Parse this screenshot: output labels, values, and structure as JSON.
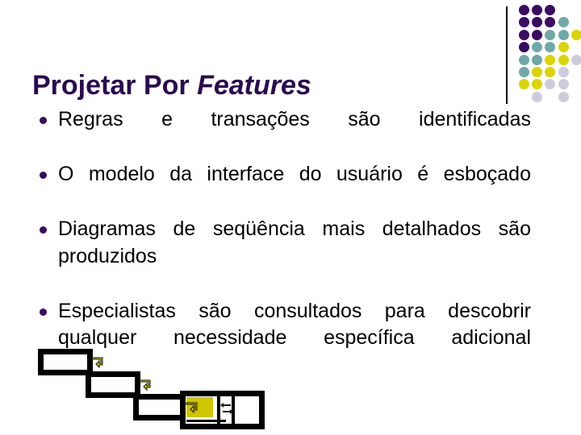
{
  "slide": {
    "title_prefix": "Projetar Por ",
    "title_emphasis": "Features",
    "title_full": "Projetar Por Features",
    "background_color": "#ffffff",
    "title_color": "#2b0a51",
    "body_text_color": "#000000",
    "bullet_marker_color": "#3b0a63"
  },
  "bullets": [
    {
      "text": "Regras e transações são identificadas"
    },
    {
      "text": "O modelo da interface do usuário é esboçado"
    },
    {
      "text": "Diagramas de seqüência mais detalhados são produzidos"
    },
    {
      "text": "Especialistas são consultados para descobrir qualquer necessidade específica adicional"
    }
  ],
  "decor": {
    "rule_color": "#000000",
    "dot_colors": {
      "purple": "#3b0a63",
      "teal": "#6fa8a8",
      "yellow": "#dbd400",
      "lavender": "#ccccdd"
    },
    "dot_grid": [
      [
        "purple",
        "purple",
        "purple",
        null,
        null
      ],
      [
        "purple",
        "purple",
        "purple",
        "teal",
        null
      ],
      [
        "purple",
        "purple",
        "teal",
        "teal",
        "yellow"
      ],
      [
        "purple",
        "teal",
        "teal",
        "yellow",
        null
      ],
      [
        "teal",
        "teal",
        "yellow",
        "yellow",
        "lavender"
      ],
      [
        "teal",
        "yellow",
        "yellow",
        "lavender",
        null
      ],
      [
        "yellow",
        "yellow",
        "lavender",
        "lavender",
        null
      ],
      [
        null,
        "lavender",
        null,
        "lavender",
        null
      ]
    ]
  },
  "cascade": {
    "box_border_color": "#000000",
    "box_fill_color": "#ffffff",
    "highlight_fill_color": "#cfc500",
    "arrow_color": "#cfc500",
    "arrow_count": 3,
    "box_count": 4,
    "swap_icon": "swap-arrows"
  }
}
